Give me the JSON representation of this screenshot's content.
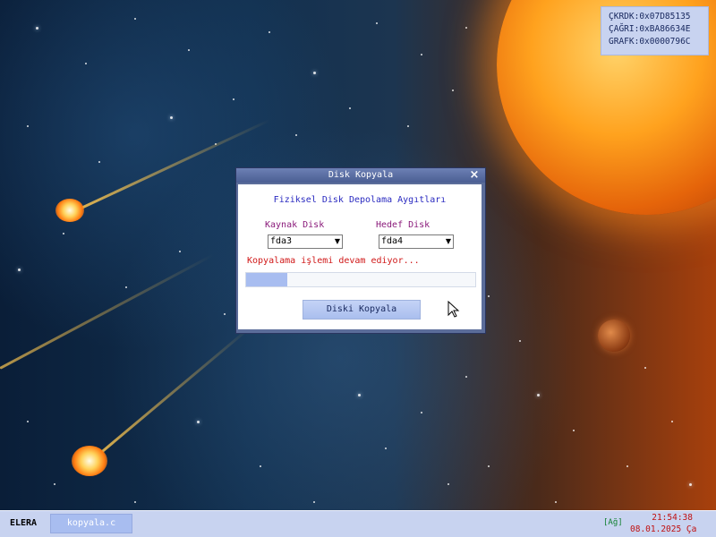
{
  "registers": [
    {
      "name": "ÇKRDK:",
      "value": "0x07D85135"
    },
    {
      "name": "ÇAĞRI:",
      "value": "0xBA86634E"
    },
    {
      "name": "GRAFK:",
      "value": "0x0000796C"
    }
  ],
  "dialog": {
    "title": "Disk Kopyala",
    "close_icon": "×",
    "heading": "Fiziksel Disk Depolama Aygıtları",
    "source_label": "Kaynak Disk",
    "source_value": "fda3",
    "target_label": "Hedef Disk",
    "target_value": "fda4",
    "dropdown_arrow": "▼",
    "status": "Kopyalama işlemi devam ediyor...",
    "progress_fraction": 0.18,
    "copy_button": "Diski Kopyala"
  },
  "taskbar": {
    "start_label": "ELERA",
    "task_item": "kopyala.c",
    "network": "[Ağ]",
    "time": "21:54:38",
    "date": "08.01.2025 Ça"
  },
  "colors": {
    "title_bar": "#5b6d9a",
    "taskbar": "#c8d3f0",
    "progress_fill": "#a8bdf0",
    "status_text": "#d01818"
  },
  "icons": {
    "close": "close-icon",
    "dropdown": "chevron-down-icon",
    "cursor": "mouse-pointer-icon"
  }
}
